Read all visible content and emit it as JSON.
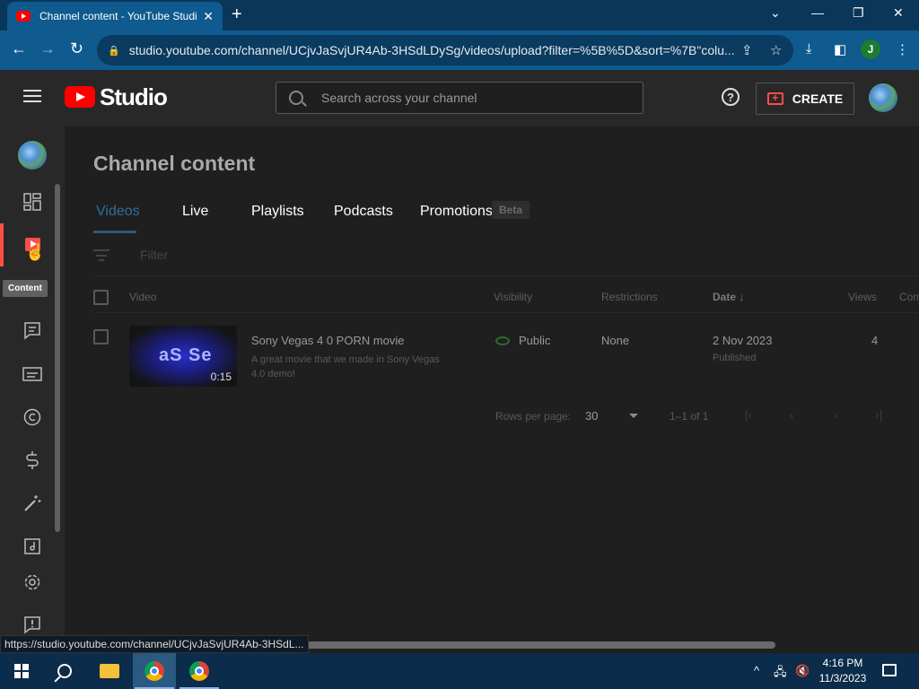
{
  "browser": {
    "tab_title": "Channel content - YouTube Studio",
    "new_tab": "+",
    "url": "studio.youtube.com/channel/UCjvJaSvjUR4Ab-3HSdLDySg/videos/upload?filter=%5B%5D&sort=%7B\"colu...",
    "profile_initial": "J",
    "status_url": "https://studio.youtube.com/channel/UCjvJaSvjUR4Ab-3HSdL..."
  },
  "header": {
    "logo_text": "Studio",
    "search_placeholder": "Search across your channel",
    "help": "?",
    "create_label": "CREATE"
  },
  "sidebar": {
    "tooltip": "Content",
    "items": [
      "avatar",
      "dashboard-icon",
      "content-icon",
      "comments-icon",
      "subtitles-icon",
      "copyright-icon",
      "earn-icon",
      "customization-icon",
      "audio-library-icon",
      "settings-icon",
      "feedback-icon"
    ]
  },
  "main": {
    "title": "Channel content",
    "tabs": [
      "Videos",
      "Live",
      "Playlists",
      "Podcasts",
      "Promotions"
    ],
    "beta_badge": "Beta",
    "filter_placeholder": "Filter",
    "columns": [
      "Video",
      "Visibility",
      "Restrictions",
      "Date",
      "Views",
      "Com"
    ],
    "rows": [
      {
        "title": "Sony Vegas 4 0 PORN movie",
        "description": "A great movie that we made in Sony Vegas 4.0 demo!",
        "thumbnail_text": "aS Se",
        "duration": "0:15",
        "visibility": "Public",
        "restrictions": "None",
        "date": "2 Nov 2023",
        "date_status": "Published",
        "views": "4"
      }
    ],
    "pagination": {
      "rows_per_page_label": "Rows per page:",
      "rows_per_page": "30",
      "range": "1–1 of 1"
    }
  },
  "taskbar": {
    "time": "4:16 PM",
    "date": "11/3/2023"
  }
}
